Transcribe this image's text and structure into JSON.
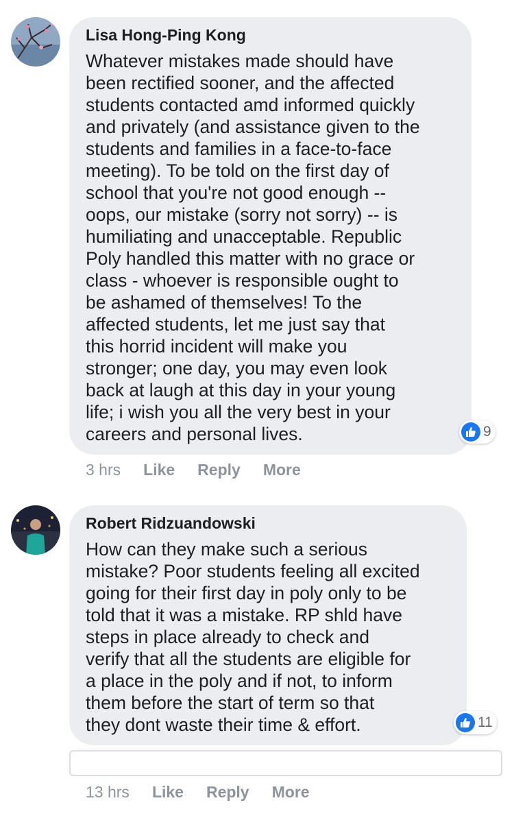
{
  "comments": [
    {
      "author": "Lisa Hong-Ping Kong",
      "lines": [
        "Whatever mistakes made should have",
        "been rectified sooner, and the affected",
        "students contacted amd informed quickly",
        "and privately (and assistance given to the",
        "students and families in a face-to-face",
        "meeting). To be told on the first day of",
        "school that you're not good enough --",
        "oops, our mistake (sorry not sorry) -- is",
        "humiliating and unacceptable. Republic",
        "Poly handled this matter with no grace or",
        "class - whoever is responsible ought to",
        "be ashamed of themselves! To the",
        "affected students, let me just say that",
        "this horrid incident will make you",
        "stronger; one day, you may even look",
        "back at laugh at this day in your young",
        "life; i wish you all the very best in your",
        "careers and personal lives."
      ],
      "reaction_count": "9",
      "time": "3 hrs",
      "like_label": "Like",
      "reply_label": "Reply",
      "more_label": "More"
    },
    {
      "author": "Robert Ridzuandowski",
      "lines": [
        "How can they make such a serious",
        "mistake? Poor students feeling all excited",
        "going for their first day in poly only to be",
        "told that it was a mistake. RP shld have",
        "steps in place already to check and",
        "verify that all the students are eligible for",
        "a place in the poly and if not, to inform",
        "them before the start of term so that",
        "they dont waste their time & effort."
      ],
      "reaction_count": "11",
      "time": "13 hrs",
      "like_label": "Like",
      "reply_label": "Reply",
      "more_label": "More"
    }
  ],
  "reply_input": {
    "placeholder": ""
  },
  "colors": {
    "bubble": "#ebedf0",
    "like_blue": "#1877f2",
    "meta_gray": "#8d949e"
  },
  "icons": {
    "reaction": "thumbs-up-icon"
  }
}
